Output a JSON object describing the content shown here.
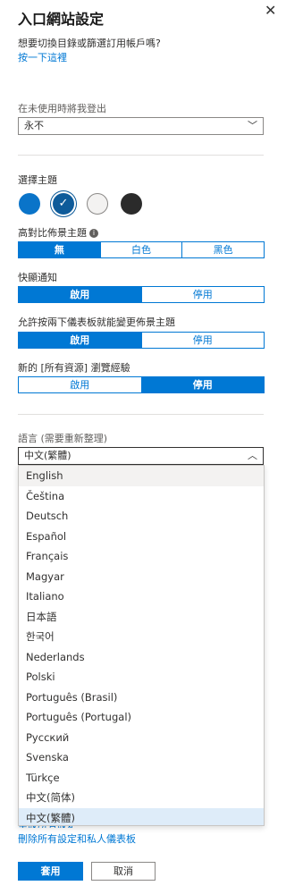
{
  "panel": {
    "title": "入口網站設定",
    "close_icon": "close-icon",
    "switch_question": "想要切換目錄或篩選訂用帳戶嗎?",
    "switch_link": "按一下這裡"
  },
  "signout": {
    "label": "在未使用時將我登出",
    "value": "永不"
  },
  "theme": {
    "label": "選擇主題",
    "swatches": [
      {
        "name": "blue",
        "color": "#0a74c9",
        "selected": false
      },
      {
        "name": "dark-blue",
        "color": "#0e5b9a",
        "selected": true
      },
      {
        "name": "light",
        "color": "#f3f2f1",
        "selected": false
      },
      {
        "name": "dark",
        "color": "#2b2b2b",
        "selected": false
      }
    ],
    "check_glyph": "✓"
  },
  "high_contrast": {
    "label": "高對比佈景主題",
    "options": [
      "無",
      "白色",
      "黑色"
    ],
    "selected": 0
  },
  "toast": {
    "label": "快顯通知",
    "options": [
      "啟用",
      "停用"
    ],
    "selected": 0
  },
  "dashboard_theme": {
    "label": "允許按兩下儀表板就能變更佈景主題",
    "options": [
      "啟用",
      "停用"
    ],
    "selected": 0
  },
  "browse": {
    "label": "新的 [所有資源] 瀏覽經驗",
    "options": [
      "啟用",
      "停用"
    ],
    "selected": 1
  },
  "language": {
    "label": "語言 (需要重新整理)",
    "value": "中文(繁體)",
    "options": [
      "English",
      "Čeština",
      "Deutsch",
      "Español",
      "Français",
      "Magyar",
      "Italiano",
      "日本語",
      "한국어",
      "Nederlands",
      "Polski",
      "Português (Brasil)",
      "Português (Portugal)",
      "Русский",
      "Svenska",
      "Türkçe",
      "中文(简体)",
      "中文(繁體)"
    ],
    "hover_index": 0,
    "selected_index": 17
  },
  "links": {
    "reset": "重設所有設定",
    "delete": "刪除所有設定和私人儀表板"
  },
  "buttons": {
    "apply": "套用",
    "cancel": "取消"
  }
}
